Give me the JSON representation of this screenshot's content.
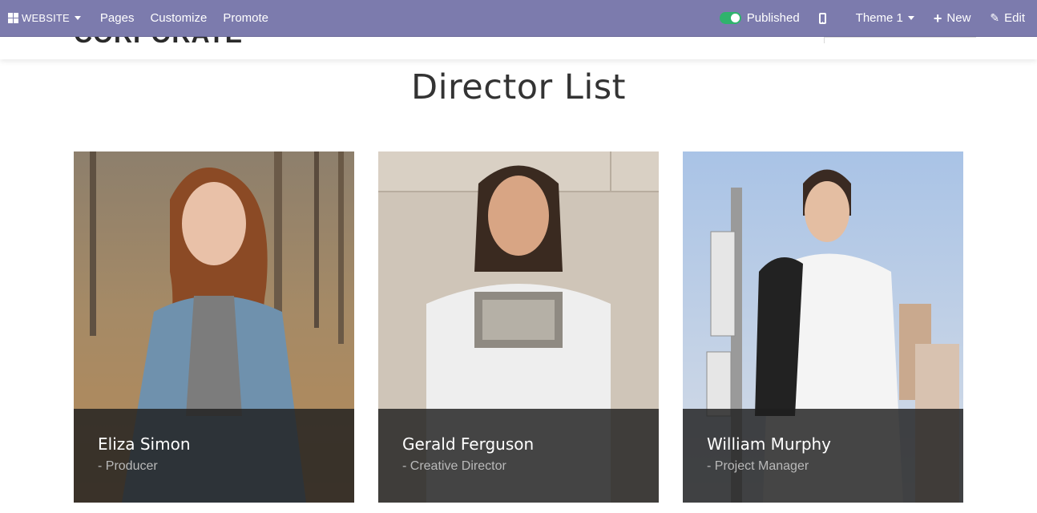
{
  "topbar": {
    "app_menu_label": "WEBSITE",
    "nav": [
      "Pages",
      "Customize",
      "Promote"
    ],
    "published_label": "Published",
    "theme_label": "Theme 1",
    "new_label": "New",
    "edit_label": "Edit"
  },
  "site": {
    "logo_text": "CORPORATE"
  },
  "main": {
    "title": "Director List",
    "directors": [
      {
        "name": "Eliza Simon",
        "role": "- Producer"
      },
      {
        "name": "Gerald Ferguson",
        "role": "- Creative Director"
      },
      {
        "name": "William Murphy",
        "role": "- Project Manager"
      }
    ]
  },
  "colors": {
    "topbar_bg": "#7c7bad",
    "toggle_on": "#2fb36c",
    "caption_bg": "#1e1e1e"
  }
}
